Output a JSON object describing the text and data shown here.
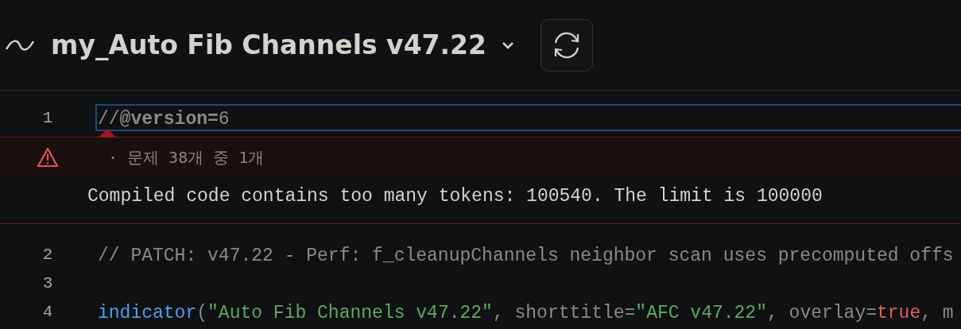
{
  "header": {
    "title": "my_Auto Fib Channels v47.22"
  },
  "editor": {
    "lines": [
      {
        "number": "1",
        "current": true,
        "tokens": [
          {
            "kind": "comment",
            "text": "//"
          },
          {
            "kind": "annotation",
            "text": "@version="
          },
          {
            "kind": "comment",
            "text": "6"
          }
        ]
      },
      {
        "number": "2",
        "current": false,
        "tokens": [
          {
            "kind": "comment",
            "text": "// PATCH: v47.22 - Perf: f_cleanupChannels neighbor scan uses precomputed offs"
          }
        ]
      },
      {
        "number": "3",
        "current": false
      },
      {
        "number": "4",
        "current": false,
        "tokens": [
          {
            "kind": "function",
            "text": "indicator"
          },
          {
            "kind": "plain",
            "text": "("
          },
          {
            "kind": "string",
            "text": "\"Auto Fib Channels v47.22\""
          },
          {
            "kind": "plain",
            "text": ", shorttitle="
          },
          {
            "kind": "string",
            "text": "\"AFC v47.22\""
          },
          {
            "kind": "plain",
            "text": ", overlay="
          },
          {
            "kind": "keyword",
            "text": "true"
          },
          {
            "kind": "plain",
            "text": ", m"
          }
        ]
      }
    ],
    "problem": {
      "counter": "· 문제 38개 중 1개",
      "message": "Compiled code contains too many tokens: 100540. The limit is 100000"
    }
  }
}
